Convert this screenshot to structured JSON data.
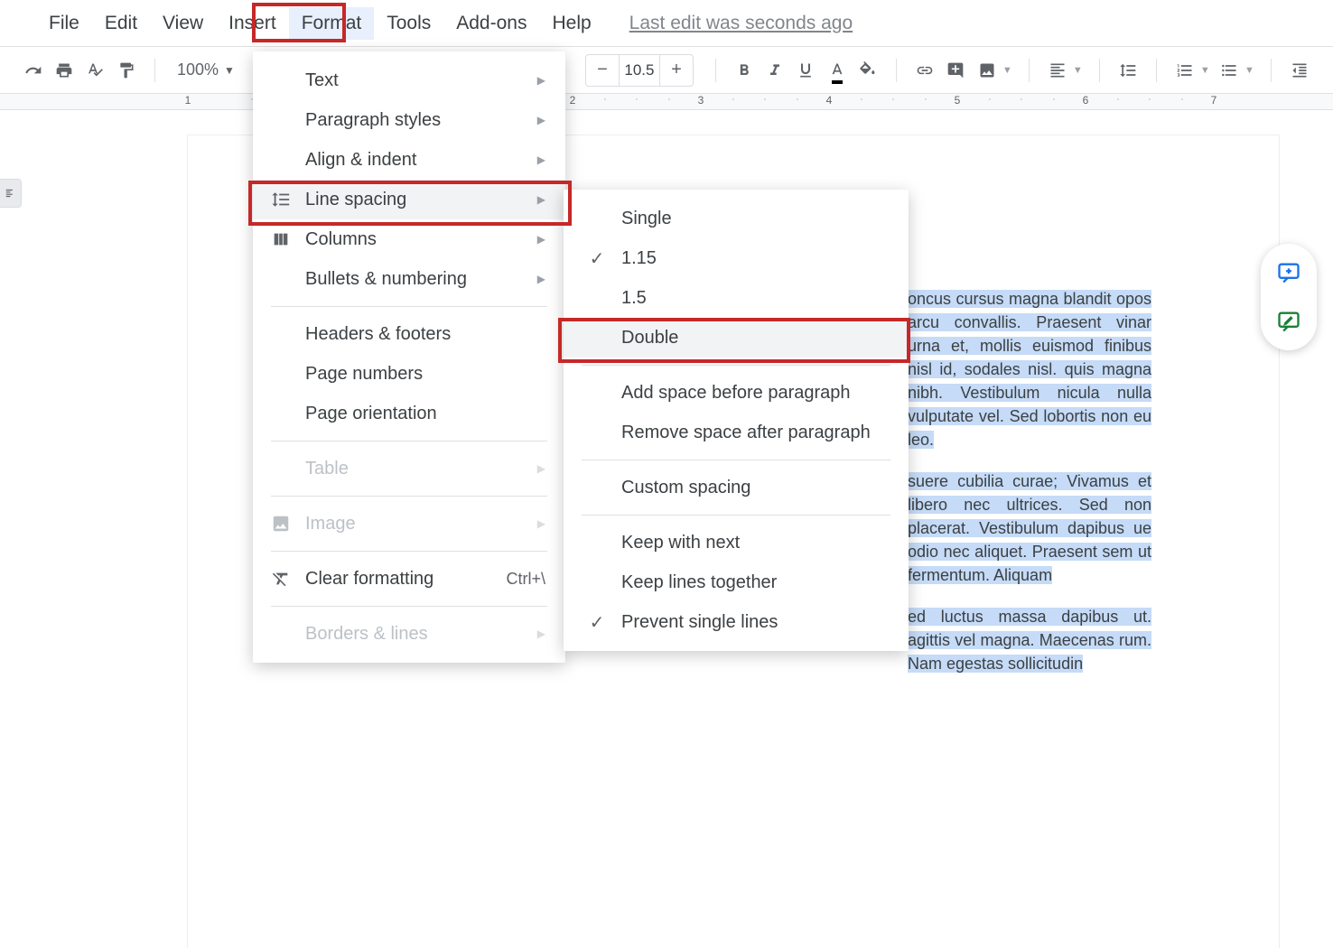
{
  "menubar": {
    "items": [
      {
        "label": "File"
      },
      {
        "label": "Edit"
      },
      {
        "label": "View"
      },
      {
        "label": "Insert"
      },
      {
        "label": "Format",
        "active": true
      },
      {
        "label": "Tools"
      },
      {
        "label": "Add-ons"
      },
      {
        "label": "Help"
      }
    ],
    "last_edit": "Last edit was seconds ago"
  },
  "toolbar": {
    "zoom": "100%",
    "font_size": "10.5"
  },
  "format_menu": {
    "items": [
      {
        "label": "Text",
        "submenu": true
      },
      {
        "label": "Paragraph styles",
        "submenu": true
      },
      {
        "label": "Align & indent",
        "submenu": true
      },
      {
        "label": "Line spacing",
        "submenu": true,
        "icon": "line-spacing",
        "active": true
      },
      {
        "label": "Columns",
        "submenu": true,
        "icon": "columns"
      },
      {
        "label": "Bullets & numbering",
        "submenu": true
      },
      {
        "sep": true
      },
      {
        "label": "Headers & footers"
      },
      {
        "label": "Page numbers"
      },
      {
        "label": "Page orientation"
      },
      {
        "sep": true
      },
      {
        "label": "Table",
        "submenu": true,
        "disabled": true
      },
      {
        "sep": true
      },
      {
        "label": "Image",
        "submenu": true,
        "icon": "image",
        "disabled": true
      },
      {
        "sep": true
      },
      {
        "label": "Clear formatting",
        "icon": "clear-format",
        "shortcut": "Ctrl+\\"
      },
      {
        "sep": true
      },
      {
        "label": "Borders & lines",
        "submenu": true,
        "disabled": true
      }
    ]
  },
  "line_spacing_menu": {
    "items": [
      {
        "label": "Single"
      },
      {
        "label": "1.15",
        "checked": true
      },
      {
        "label": "1.5"
      },
      {
        "label": "Double",
        "hover": true
      },
      {
        "sep": true
      },
      {
        "label": "Add space before paragraph"
      },
      {
        "label": "Remove space after paragraph"
      },
      {
        "sep": true
      },
      {
        "label": "Custom spacing"
      },
      {
        "sep": true
      },
      {
        "label": "Keep with next"
      },
      {
        "label": "Keep lines together"
      },
      {
        "label": "Prevent single lines",
        "checked": true
      }
    ]
  },
  "ruler_numbers": [
    "1",
    "2",
    "3",
    "4",
    "5",
    "6",
    "7"
  ],
  "doc": {
    "p1": "oncus cursus magna blandit opos arcu convallis. Praesent vinar urna et, mollis euismod  finibus nisl id, sodales nisl.  quis magna nibh. Vestibulum nicula nulla vulputate vel. Sed  lobortis non eu leo.",
    "p2": "suere cubilia curae; Vivamus et libero nec ultrices. Sed non  placerat. Vestibulum dapibus ue odio nec aliquet. Praesent sem ut fermentum. Aliquam",
    "p3": "ed luctus massa dapibus ut. agittis vel magna. Maecenas rum. Nam egestas sollicitudin"
  }
}
